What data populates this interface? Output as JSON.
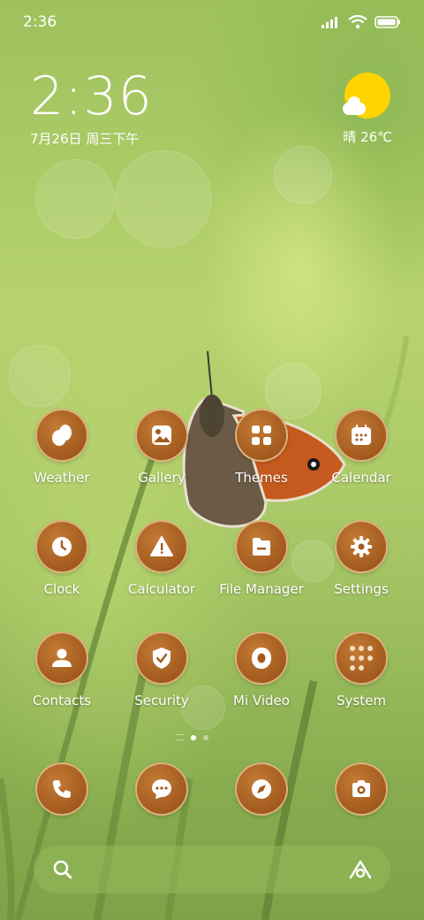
{
  "status_bar": {
    "time": "2:36",
    "icons": [
      "signal-icon",
      "wifi-icon",
      "battery-icon"
    ]
  },
  "clock_widget": {
    "time": "2:36",
    "date": "7月26日 周三下午"
  },
  "weather_widget": {
    "icon": "partly-sunny-icon",
    "text": "晴 26℃"
  },
  "apps": [
    {
      "label": "Weather",
      "icon": "weather-icon"
    },
    {
      "label": "Gallery",
      "icon": "gallery-icon"
    },
    {
      "label": "Themes",
      "icon": "themes-icon"
    },
    {
      "label": "Calendar",
      "icon": "calendar-icon"
    },
    {
      "label": "Clock",
      "icon": "clock-icon"
    },
    {
      "label": "Calculator",
      "icon": "calculator-icon"
    },
    {
      "label": "File Manager",
      "icon": "file-manager-icon"
    },
    {
      "label": "Settings",
      "icon": "settings-icon"
    },
    {
      "label": "Contacts",
      "icon": "contacts-icon"
    },
    {
      "label": "Security",
      "icon": "security-icon"
    },
    {
      "label": "Mi Video",
      "icon": "video-icon"
    },
    {
      "label": "System",
      "icon": "folder-icon"
    }
  ],
  "dock": [
    "phone-icon",
    "messages-icon",
    "browser-icon",
    "camera-icon"
  ],
  "page_indicator": {
    "pages": 2,
    "active": 1
  },
  "search": {
    "icon": "search-icon",
    "assistant_icon": "assistant-icon"
  },
  "colors": {
    "icon_fill": "#a25a1e",
    "icon_border": "#e6be8c",
    "sun": "#ffd400"
  }
}
